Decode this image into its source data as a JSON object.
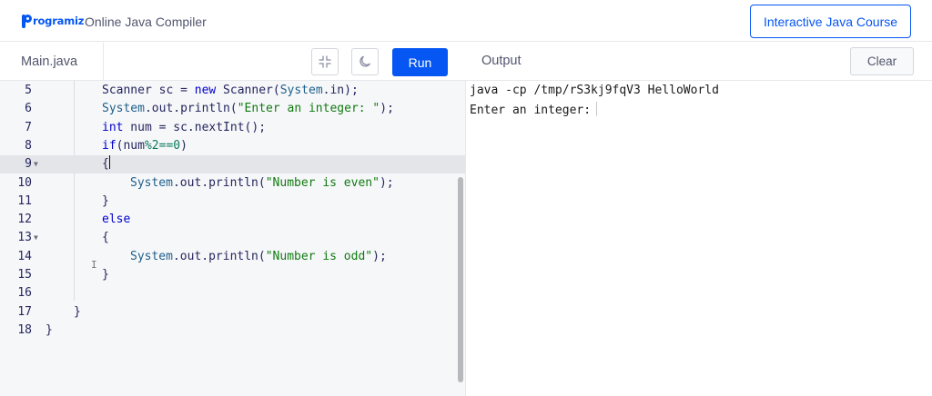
{
  "header": {
    "logo_text": "rogramiz",
    "title": "Online Java Compiler",
    "course_button": "Interactive Java Course"
  },
  "editor": {
    "file_tab": "Main.java",
    "run_label": "Run",
    "lines": [
      {
        "num": "5",
        "code": "Scanner sc = new Scanner(System.in);"
      },
      {
        "num": "6",
        "code": "System.out.println(\"Enter an integer: \");"
      },
      {
        "num": "7",
        "code": "int num = sc.nextInt();"
      },
      {
        "num": "8",
        "code": "if(num%2==0)"
      },
      {
        "num": "9",
        "code": "{"
      },
      {
        "num": "10",
        "code": "System.out.println(\"Number is even\");"
      },
      {
        "num": "11",
        "code": "}"
      },
      {
        "num": "12",
        "code": "else"
      },
      {
        "num": "13",
        "code": "{"
      },
      {
        "num": "14",
        "code": "System.out.println(\"Number is odd\");"
      },
      {
        "num": "15",
        "code": "}"
      },
      {
        "num": "16",
        "code": ""
      },
      {
        "num": "17",
        "code": "}"
      },
      {
        "num": "18",
        "code": "}"
      }
    ],
    "active_line": "9"
  },
  "output": {
    "title": "Output",
    "clear_label": "Clear",
    "lines": [
      "java -cp /tmp/rS3kj9fqV3 HelloWorld",
      "Enter an integer:"
    ]
  },
  "colors": {
    "accent": "#0556f3",
    "keyword": "#0000cc",
    "string": "#117a11"
  },
  "icons": [
    "collapse-icon",
    "dark-mode-moon-icon",
    "fold-arrow-icon",
    "text-cursor-icon"
  ]
}
